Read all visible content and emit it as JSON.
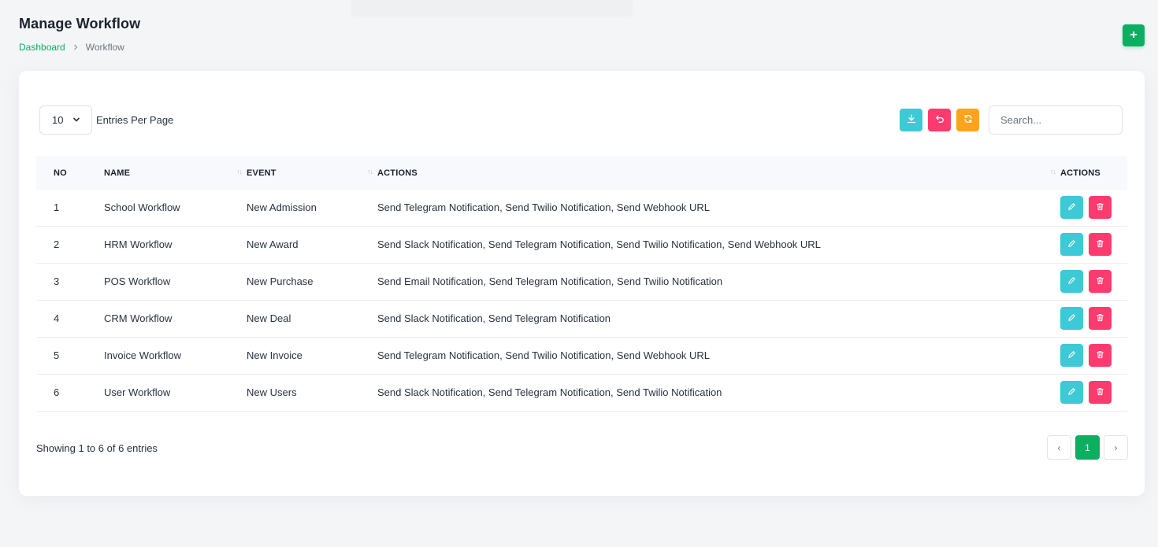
{
  "header": {
    "title": "Manage Workflow",
    "breadcrumb": [
      {
        "label": "Dashboard"
      },
      {
        "label": "Workflow"
      }
    ],
    "add_button": "+"
  },
  "controls": {
    "per_page_value": "10",
    "per_page_label": "Entries Per Page",
    "search_placeholder": "Search..."
  },
  "table": {
    "columns": [
      "NO",
      "NAME",
      "EVENT",
      "ACTIONS",
      "ACTIONS"
    ],
    "rows": [
      {
        "no": "1",
        "name": "School Workflow",
        "event": "New Admission",
        "actions": "Send Telegram Notification, Send Twilio Notification, Send Webhook URL"
      },
      {
        "no": "2",
        "name": "HRM Workflow",
        "event": "New Award",
        "actions": "Send Slack Notification, Send Telegram Notification, Send Twilio Notification, Send Webhook URL"
      },
      {
        "no": "3",
        "name": "POS Workflow",
        "event": "New Purchase",
        "actions": "Send Email Notification, Send Telegram Notification, Send Twilio Notification"
      },
      {
        "no": "4",
        "name": "CRM Workflow",
        "event": "New Deal",
        "actions": "Send Slack Notification, Send Telegram Notification"
      },
      {
        "no": "5",
        "name": "Invoice Workflow",
        "event": "New Invoice",
        "actions": "Send Telegram Notification, Send Twilio Notification, Send Webhook URL"
      },
      {
        "no": "6",
        "name": "User Workflow",
        "event": "New Users",
        "actions": "Send Slack Notification, Send Telegram Notification, Send Twilio Notification"
      }
    ]
  },
  "footer": {
    "info": "Showing 1 to 6 of 6 entries",
    "current_page": "1",
    "prev": "‹",
    "next": "›"
  },
  "colors": {
    "primary": "#0caf60",
    "info": "#3ec9d6",
    "danger": "#ff3a6e",
    "warning": "#ffa21d"
  }
}
